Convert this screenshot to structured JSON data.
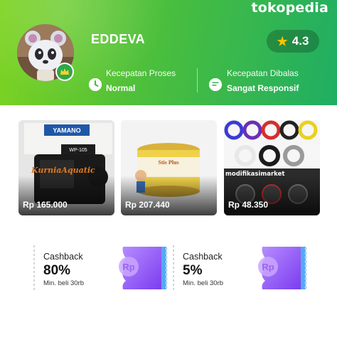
{
  "app": {
    "logo_text": "tokopedia"
  },
  "shop": {
    "name": "EDDEVA",
    "rating": "4.3",
    "stats": [
      {
        "label": "Kecepatan Proses",
        "value": "Normal",
        "icon": "clock-icon"
      },
      {
        "label": "Kecepatan Dibalas",
        "value": "Sangat Responsif",
        "icon": "chat-icon"
      }
    ]
  },
  "products": [
    {
      "price": "Rp 165.000",
      "image_brand": "YAMANO",
      "image_model": "WP-105",
      "image_caption": "KurniaAquatic"
    },
    {
      "price": "Rp 207.440",
      "image_brand": "Stis Plus"
    },
    {
      "price": "Rp 48.350",
      "image_caption": "modifikasimarket"
    }
  ],
  "vouchers": [
    {
      "title": "Cashback",
      "amount": "80%",
      "minimum": "Min. beli 30rb",
      "ticket_label": "Rp"
    },
    {
      "title": "Cashback",
      "amount": "5%",
      "minimum": "Min. beli 30rb",
      "ticket_label": "Rp"
    }
  ],
  "colors": {
    "header_start": "#7ed321",
    "header_end": "#1fae63",
    "rating_star": "#ffc400",
    "ticket_purple": "#8f5cf5",
    "ticket_edge": "#56a8f3"
  }
}
